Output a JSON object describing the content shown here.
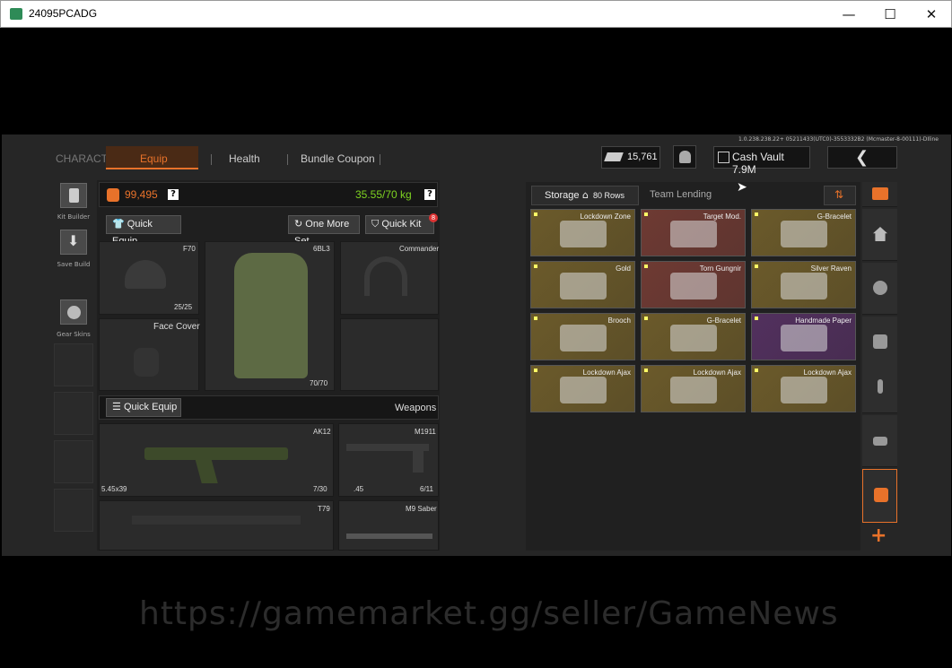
{
  "window": {
    "title": "24095PCADG",
    "minimize": "—",
    "maximize": "☐",
    "close": "✕"
  },
  "version_text": "1.0.238.238.22+ 05211433(UTC0)-3553332B2 (Mcmaster-8-00111)-DIline",
  "nav": {
    "character": "CHARACTER",
    "equip": "Equip",
    "health": "Health",
    "bundle": "Bundle Coupon"
  },
  "header": {
    "money": "15,761",
    "cash_vault": "Cash Vault 7.9M"
  },
  "left_sidebar": {
    "kit_builder": "Kit Builder",
    "save_build": "Save Build",
    "gear_skins": "Gear Skins"
  },
  "equip_panel": {
    "value": "99,495",
    "weight": "35.55/70 kg",
    "quick_equip": "Quick Equip",
    "one_more_set": "One More Set",
    "quick_kit": "Quick Kit",
    "quick_kit_badge": "8",
    "helmet": {
      "name": "F70",
      "count": "25/25"
    },
    "armor": {
      "name": "6BL3",
      "count": "70/70"
    },
    "headset": {
      "name": "Commander"
    },
    "face_cover": {
      "name": "Face Cover"
    },
    "weapons_quick_equip": "Quick Equip",
    "weapons_label": "Weapons",
    "weapons": [
      {
        "name": "AK12",
        "ammo": "5.45x39",
        "count": "7/30"
      },
      {
        "name": "M1911",
        "ammo": ".45",
        "count": "6/11"
      },
      {
        "name": "T79"
      },
      {
        "name": "M9 Saber"
      }
    ]
  },
  "storage": {
    "tab_storage": "Storage",
    "rows": "80 Rows",
    "tab_team": "Team Lending",
    "items": [
      {
        "name": "Lockdown Zone",
        "bg": "#6b5a2a"
      },
      {
        "name": "Target Mod.",
        "bg": "#6e3a33"
      },
      {
        "name": "G-Bracelet",
        "bg": "#6b5a2a"
      },
      {
        "name": "Gold",
        "bg": "#6b5a2a"
      },
      {
        "name": "Torn Gungnir",
        "bg": "#6e3a33"
      },
      {
        "name": "Silver Raven",
        "bg": "#6b5a2a"
      },
      {
        "name": "Brooch",
        "bg": "#6b5a2a"
      },
      {
        "name": "G-Bracelet",
        "bg": "#6b5a2a"
      },
      {
        "name": "Handmade Paper",
        "bg": "#52305e"
      },
      {
        "name": "Lockdown Ajax",
        "bg": "#6b5a2a"
      },
      {
        "name": "Lockdown Ajax",
        "bg": "#6b5a2a"
      },
      {
        "name": "Lockdown Ajax",
        "bg": "#6b5a2a"
      }
    ]
  },
  "plus": "+",
  "watermark": "https://gamemarket.gg/seller/GameNews"
}
